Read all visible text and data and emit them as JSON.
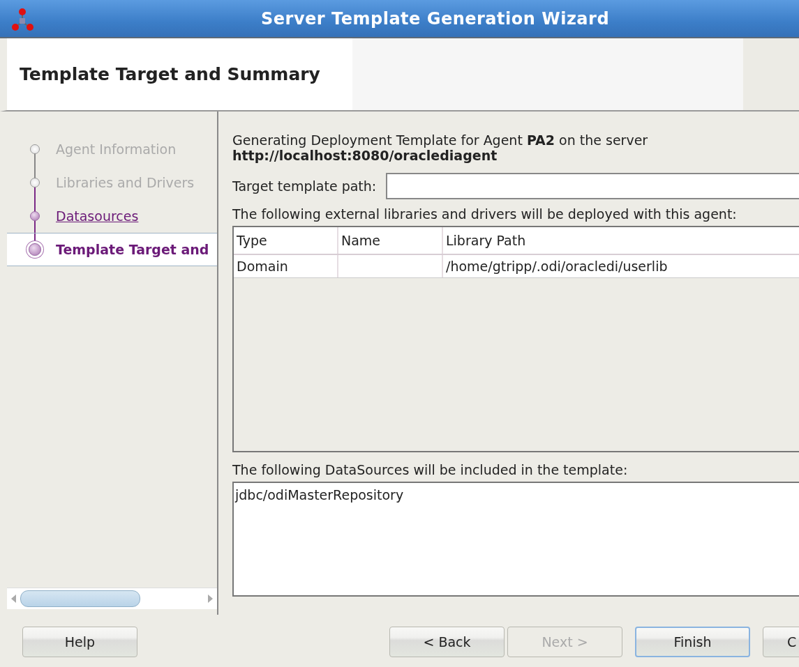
{
  "window": {
    "title": "Server Template Generation Wizard"
  },
  "header": {
    "title": "Template Target and Summary"
  },
  "steps": [
    {
      "label": "Agent Information",
      "visited": false,
      "selected": false
    },
    {
      "label": "Libraries and Drivers",
      "visited": false,
      "selected": false
    },
    {
      "label": "Datasources",
      "visited": true,
      "selected": false
    },
    {
      "label": "Template Target and",
      "visited": true,
      "selected": true
    }
  ],
  "intro": {
    "text": "Generating Deployment Template for Agent **PA2** on the server",
    "url": "http://localhost:8080/oraclediagent"
  },
  "target_path": {
    "label": "Target template path:"
  },
  "libraries": {
    "caption": "The following external libraries and drivers will be deployed with this agent:",
    "columns": [
      "Type",
      "Name",
      "Library Path"
    ],
    "rows": [
      [
        "Domain",
        "",
        "/home/gtripp/.odi/oracledi/userlib"
      ]
    ]
  },
  "datasources": {
    "caption": "The following DataSources will be included in the template:",
    "items": [
      "jdbc/odiMasterRepository"
    ]
  },
  "buttons": [
    {
      "label": "Help",
      "kind": "help",
      "disabled": false,
      "default": false
    },
    {
      "label": "< Back",
      "kind": "nav",
      "disabled": false,
      "default": false
    },
    {
      "label": "Next >",
      "kind": "nav",
      "disabled": true,
      "default": false
    },
    {
      "label": "Finish",
      "kind": "finish",
      "disabled": false,
      "default": true
    },
    {
      "label": "C",
      "kind": "cut",
      "disabled": false,
      "default": false
    }
  ]
}
